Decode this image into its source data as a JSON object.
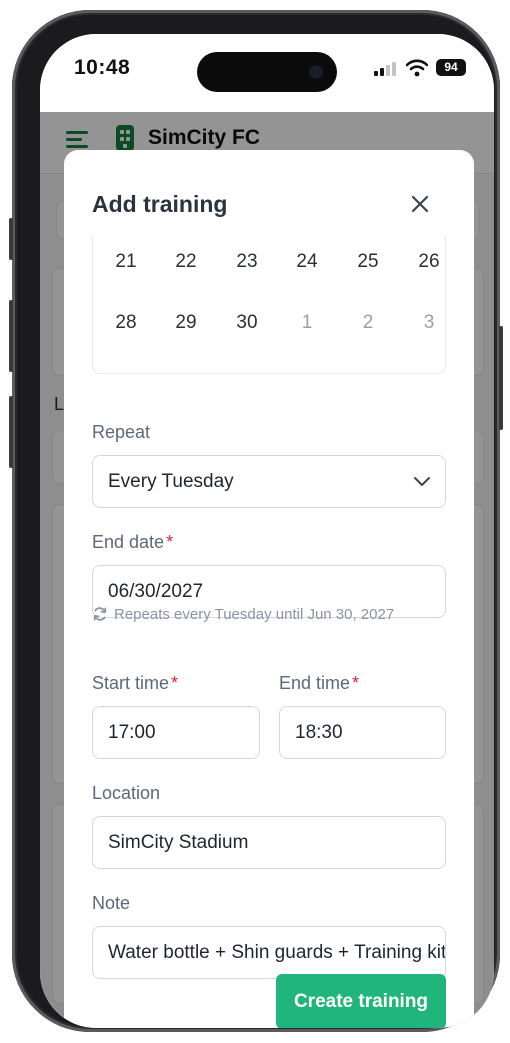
{
  "status_bar": {
    "time": "10:48",
    "battery": "94"
  },
  "app": {
    "club_name": "SimCity FC",
    "peek_letter": "L"
  },
  "modal": {
    "title": "Add training",
    "calendar": {
      "rows": [
        [
          {
            "day": "21",
            "muted": false
          },
          {
            "day": "22",
            "muted": false
          },
          {
            "day": "23",
            "muted": false
          },
          {
            "day": "24",
            "muted": false
          },
          {
            "day": "25",
            "muted": false
          },
          {
            "day": "26",
            "muted": false
          }
        ],
        [
          {
            "day": "28",
            "muted": false
          },
          {
            "day": "29",
            "muted": false
          },
          {
            "day": "30",
            "muted": false
          },
          {
            "day": "1",
            "muted": true
          },
          {
            "day": "2",
            "muted": true
          },
          {
            "day": "3",
            "muted": true
          }
        ]
      ]
    },
    "repeat": {
      "label": "Repeat",
      "value": "Every Tuesday"
    },
    "end_date": {
      "label": "End date",
      "required": "*",
      "value": "06/30/2027"
    },
    "repeat_hint": "Repeats every Tuesday until Jun 30, 2027",
    "start_time": {
      "label": "Start time",
      "required": "*",
      "value": "17:00"
    },
    "end_time": {
      "label": "End time",
      "required": "*",
      "value": "18:30"
    },
    "location": {
      "label": "Location",
      "value": "SimCity Stadium"
    },
    "note": {
      "label": "Note",
      "value": "Water bottle + Shin guards + Training kit"
    },
    "submit_label": "Create training"
  },
  "colors": {
    "accent": "#20b57a",
    "brand": "#15803d",
    "required": "#e11d48"
  },
  "icons": [
    "menu-icon",
    "club-logo-icon",
    "close-icon",
    "chevron-down-icon",
    "repeat-icon",
    "signal-icon",
    "wifi-icon",
    "battery-icon"
  ]
}
